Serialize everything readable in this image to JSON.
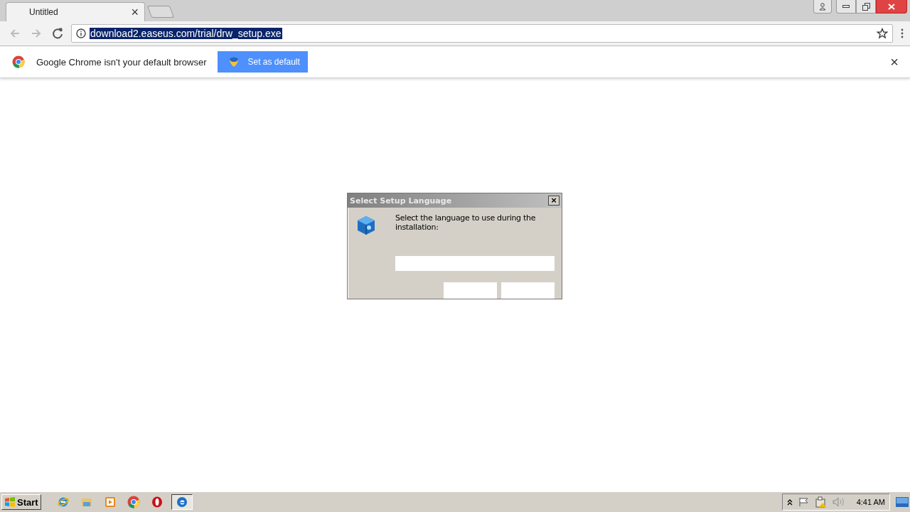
{
  "browser": {
    "tabs": [
      {
        "title": "Untitled",
        "close": "×",
        "selected": true
      }
    ],
    "address_bar": {
      "url": "download2.easeus.com/trial/drw_setup.exe",
      "selected": true
    },
    "infobar": {
      "message": "Google Chrome isn't your default browser",
      "button": "Set as default",
      "close": "×"
    }
  },
  "dialog": {
    "title": "Select Setup Language",
    "close": "×",
    "message": "Select the language to use during the installation:"
  },
  "taskbar": {
    "start": "Start",
    "tasks": [
      {
        "kind": "ie",
        "selected": false
      },
      {
        "kind": "folder",
        "selected": false
      },
      {
        "kind": "media",
        "selected": false
      },
      {
        "kind": "chrome",
        "selected": false
      },
      {
        "kind": "opera",
        "selected": false
      },
      {
        "kind": "edge",
        "selected": true
      }
    ],
    "clock": "4:41 AM"
  }
}
